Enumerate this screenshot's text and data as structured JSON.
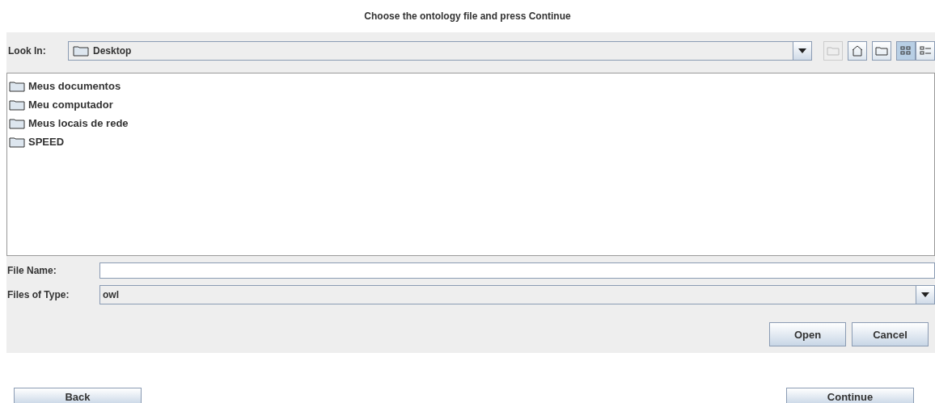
{
  "title": "Choose the ontology file and press Continue",
  "look_in": {
    "label": "Look In:",
    "value": "Desktop"
  },
  "toolbar": [
    {
      "kind": "up",
      "disabled": true
    },
    {
      "kind": "home",
      "disabled": false
    },
    {
      "kind": "new-folder",
      "disabled": false
    }
  ],
  "views": [
    {
      "kind": "list",
      "selected": true
    },
    {
      "kind": "details",
      "selected": false
    }
  ],
  "files": [
    {
      "name": "Meus documentos"
    },
    {
      "name": "Meu computador"
    },
    {
      "name": "Meus locais de rede"
    },
    {
      "name": "SPEED"
    }
  ],
  "file_name": {
    "label": "File Name:"
  },
  "file_type": {
    "label": "Files of Type:",
    "value": "owl"
  },
  "dialog_buttons": [
    "Open",
    "Cancel"
  ],
  "nav_buttons": [
    "Back",
    "Continue"
  ]
}
